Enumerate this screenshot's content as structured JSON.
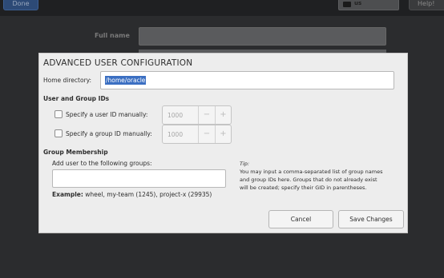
{
  "background": {
    "done_label": "Done",
    "keyboard_layout": "us",
    "help_label": "Help!",
    "full_name_label": "Full name"
  },
  "dialog": {
    "title": "ADVANCED USER CONFIGURATION",
    "home_directory_label": "Home directory:",
    "home_directory_value": "/home/oracle",
    "ids_section_title": "User and Group IDs",
    "user_id_label": "Specify a user ID manually:",
    "user_id_value": "1000",
    "group_id_label": "Specify a group ID manually:",
    "group_id_value": "1000",
    "minus_glyph": "−",
    "plus_glyph": "+",
    "membership_title": "Group Membership",
    "groups_label": "Add user to the following groups:",
    "groups_value": "",
    "example_prefix": "Example:",
    "example_text": " wheel, my-team (1245), project-x (29935)",
    "tip_head": "Tip:",
    "tip_body": "You may input a comma-separated list of group names and group IDs here. Groups that do not already exist will be created; specify their GID in parentheses.",
    "cancel_label": "Cancel",
    "save_label": "Save Changes"
  },
  "colors": {
    "selection": "#3b6fc2",
    "dialog_bg": "#ededed",
    "backdrop": "#2b2c2e"
  }
}
